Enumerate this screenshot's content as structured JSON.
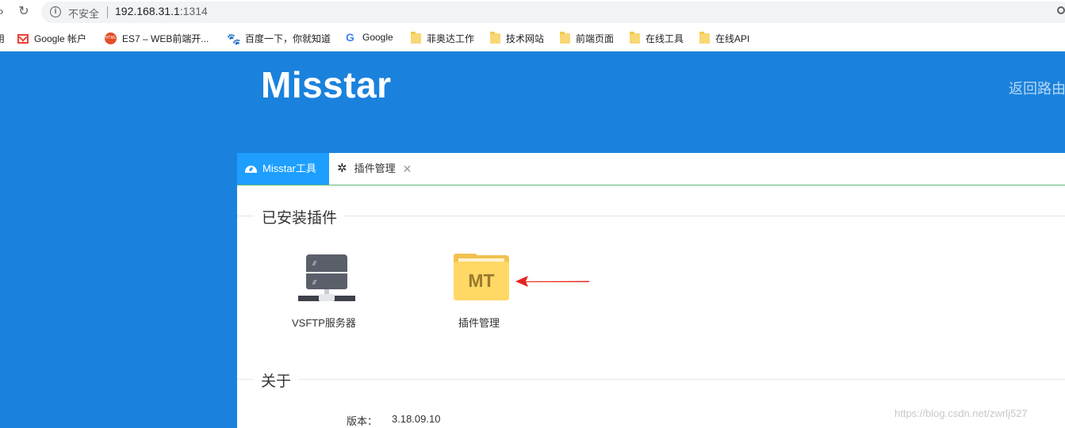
{
  "browser": {
    "insecure_label": "不安全",
    "url_host": "192.168.31.1",
    "url_port": ":1314"
  },
  "bookmarks": [
    {
      "label": "Google 帐户",
      "icon": "gmail-icon"
    },
    {
      "label": "ES7 – WEB前端开...",
      "icon": "html-badge-icon"
    },
    {
      "label": "百度一下，你就知道",
      "icon": "baidu-paw-icon"
    },
    {
      "label": "Google",
      "icon": "google-g-icon"
    },
    {
      "label": "菲奥达工作",
      "icon": "folder-icon"
    },
    {
      "label": "技术网站",
      "icon": "folder-icon"
    },
    {
      "label": "前端页面",
      "icon": "folder-icon"
    },
    {
      "label": "在线工具",
      "icon": "folder-icon"
    },
    {
      "label": "在线API",
      "icon": "folder-icon"
    }
  ],
  "header": {
    "brand": "Misstar",
    "back_link": "返回路由"
  },
  "tabs": [
    {
      "label": "Misstar工具",
      "icon": "dashboard-icon",
      "active": true
    },
    {
      "label": "插件管理",
      "icon": "gear-icon",
      "active": false
    }
  ],
  "installed": {
    "legend": "已安装插件",
    "plugins": [
      {
        "label": "VSFTP服务器",
        "icon": "server-icon"
      },
      {
        "label": "插件管理",
        "icon": "folder-icon",
        "badge": "MT"
      }
    ]
  },
  "about": {
    "legend": "关于",
    "version_label": "版本：",
    "version_value": "3.18.09.10"
  },
  "watermark": "https://blog.csdn.net/zwrlj527",
  "colors": {
    "page_bg": "#1a82dd",
    "tab_active": "#1e9fff",
    "tab_underline": "#5fb878",
    "arrow": "#e8231e"
  }
}
